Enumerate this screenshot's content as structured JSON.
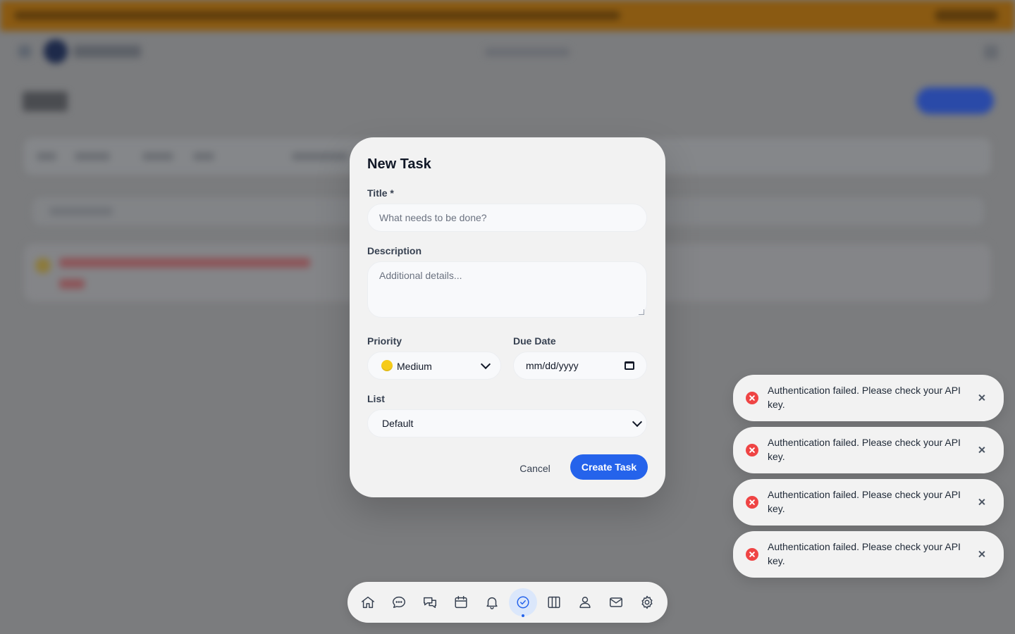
{
  "modal": {
    "title": "New Task",
    "title_label": "Title *",
    "title_placeholder": "What needs to be done?",
    "description_label": "Description",
    "description_placeholder": "Additional details...",
    "priority_label": "Priority",
    "priority_value": "Medium",
    "due_date_label": "Due Date",
    "due_date_value": "mm/dd/yyyy",
    "list_label": "List",
    "list_value": "Default",
    "cancel_label": "Cancel",
    "create_label": "Create Task"
  },
  "toasts": [
    {
      "message": "Authentication failed. Please check your API key."
    },
    {
      "message": "Authentication failed. Please check your API key."
    },
    {
      "message": "Authentication failed. Please check your API key."
    },
    {
      "message": "Authentication failed. Please check your API key."
    }
  ],
  "dock": {
    "items": [
      "home-icon",
      "chat-icon",
      "conversations-icon",
      "calendar-icon",
      "bell-icon",
      "check-circle-icon",
      "columns-icon",
      "user-icon",
      "mail-icon",
      "gear-icon"
    ],
    "active": "check-circle-icon"
  },
  "colors": {
    "accent": "#2563eb",
    "error": "#ef4444",
    "priority_medium": "#f6cb19"
  }
}
